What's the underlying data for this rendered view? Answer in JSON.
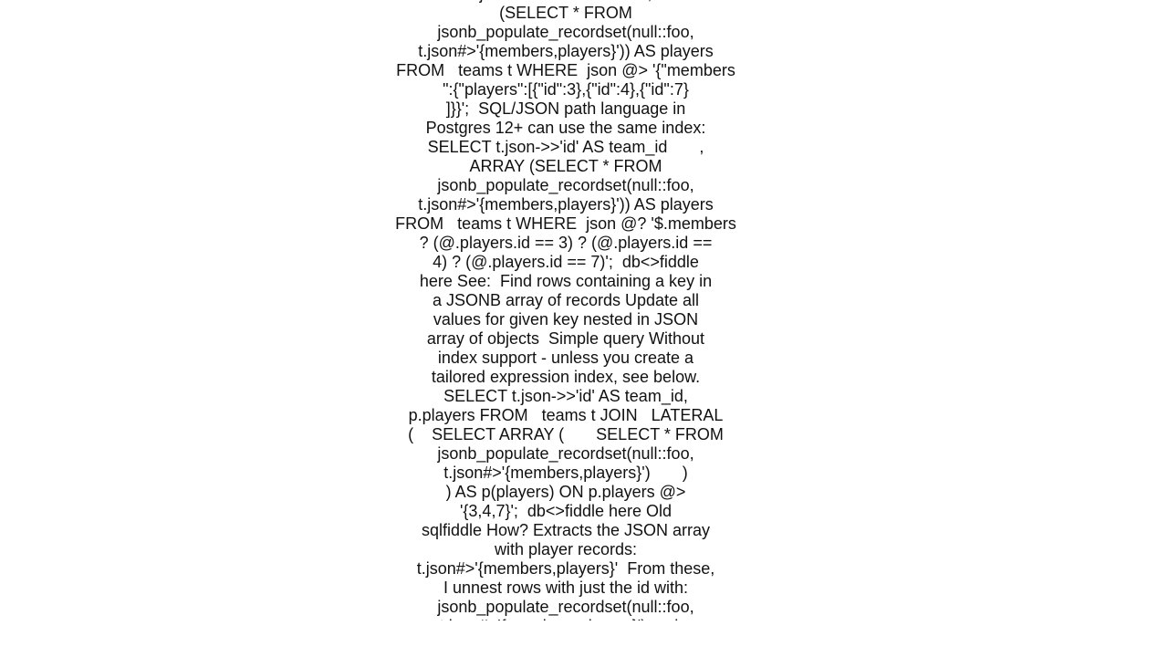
{
  "document": {
    "lines": [
      "j                                    ,",
      "(SELECT * FROM",
      "jsonb_populate_recordset(null::foo,",
      "t.json#>'{members,players}')) AS players",
      "FROM   teams t WHERE  json @> '{\"members",
      "\":{\"players\":[{\"id\":3},{\"id\":4},{\"id\":7}",
      "]}}';  SQL/JSON path language in",
      "Postgres 12+ can use the same index:",
      "SELECT t.json->>'id' AS team_id       ,",
      "ARRAY (SELECT * FROM",
      "jsonb_populate_recordset(null::foo,",
      "t.json#>'{members,players}')) AS players",
      "FROM   teams t WHERE  json @? '$.members",
      "? (@.players.id == 3) ? (@.players.id ==",
      "4) ? (@.players.id == 7)';  db<>fiddle",
      "here See:  Find rows containing a key in",
      "a JSONB array of records Update all",
      "values for given key nested in JSON",
      "array of objects  Simple query Without",
      "index support - unless you create a",
      "tailored expression index, see below.",
      "SELECT t.json->>'id' AS team_id,",
      "p.players FROM   teams t JOIN   LATERAL",
      "(    SELECT ARRAY (       SELECT * FROM",
      "jsonb_populate_recordset(null::foo,",
      "t.json#>'{members,players}')       )",
      ") AS p(players) ON p.players @>",
      "'{3,4,7}';  db<>fiddle here Old",
      "sqlfiddle How? Extracts the JSON array",
      "with player records:",
      "t.json#>'{members,players}'  From these,",
      "I unnest rows with just the id with:",
      "jsonb_populate_recordset(null::foo,",
      "t.json#>'{members,players}') and..."
    ]
  }
}
